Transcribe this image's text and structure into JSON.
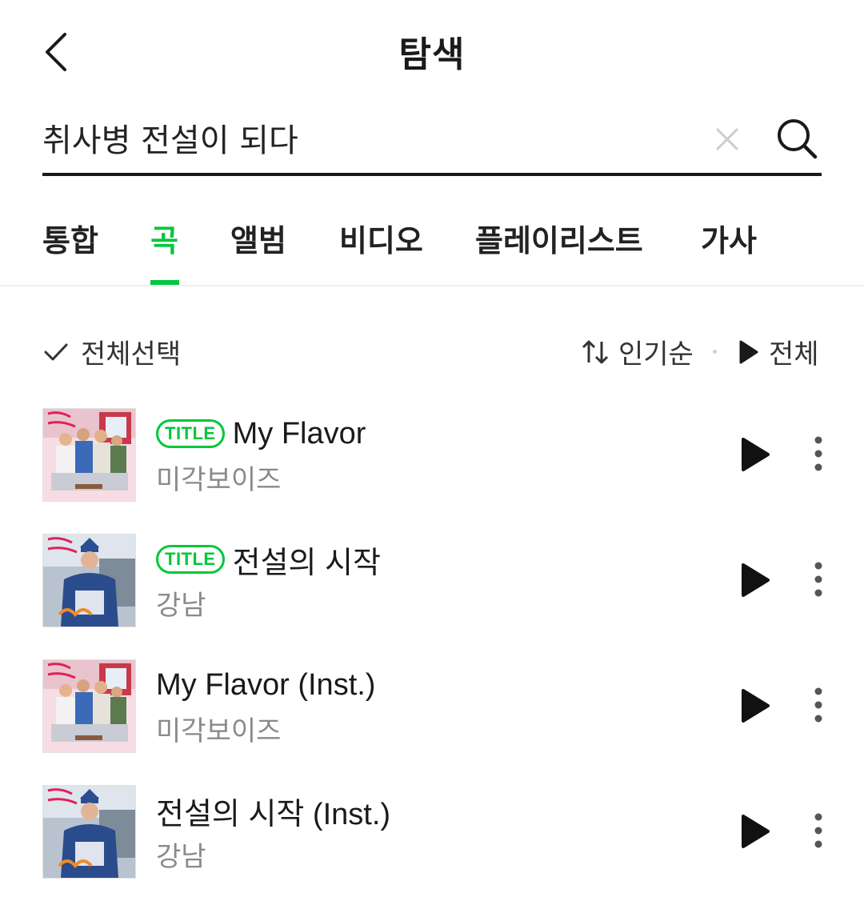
{
  "header": {
    "title": "탐색",
    "back_icon": "chevron-left-icon"
  },
  "search": {
    "query": "취사병 전설이 되다",
    "placeholder": "",
    "clear_icon": "close-icon",
    "search_icon": "search-icon"
  },
  "tabs": [
    {
      "label": "통합",
      "active": false
    },
    {
      "label": "곡",
      "active": true
    },
    {
      "label": "앨범",
      "active": false
    },
    {
      "label": "비디오",
      "active": false
    },
    {
      "label": "플레이리스트",
      "active": false
    },
    {
      "label": "가사",
      "active": false
    }
  ],
  "toolbar": {
    "select_all": "전체선택",
    "sort": "인기순",
    "play_all": "전체"
  },
  "songs": [
    {
      "title": "My Flavor",
      "artist": "미각보이즈",
      "badge": "TITLE",
      "cover": "my-flavor"
    },
    {
      "title": "전설의 시작",
      "artist": "강남",
      "badge": "TITLE",
      "cover": "legend-start"
    },
    {
      "title": "My Flavor (Inst.)",
      "artist": "미각보이즈",
      "badge": "",
      "cover": "my-flavor"
    },
    {
      "title": "전설의 시작 (Inst.)",
      "artist": "강남",
      "badge": "",
      "cover": "legend-start"
    }
  ],
  "colors": {
    "accent": "#00c73c",
    "text_primary": "#1a1a1a",
    "text_secondary": "#8a8a8a"
  }
}
